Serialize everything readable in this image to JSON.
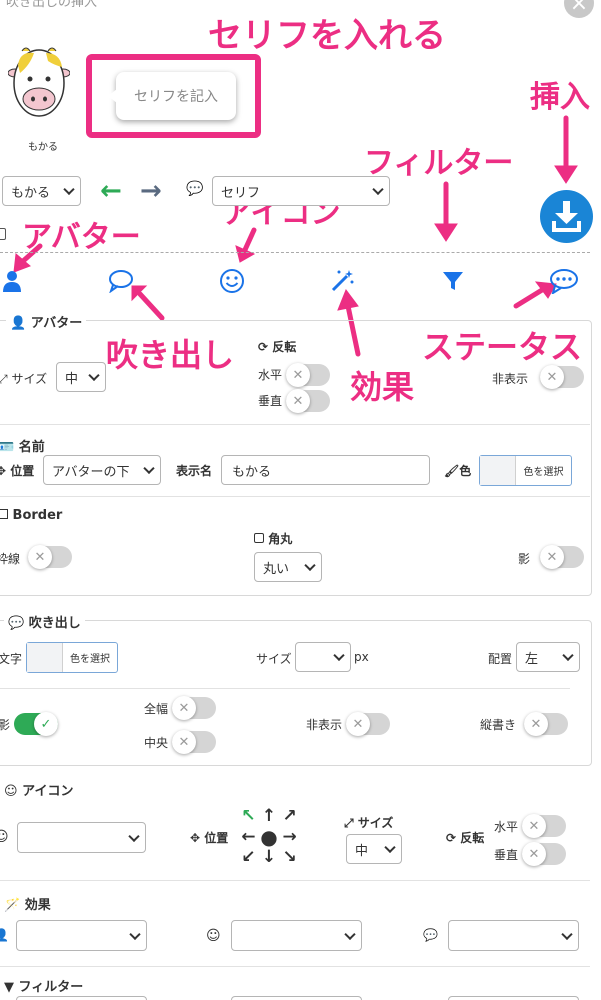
{
  "window": {
    "title": "吹き出しの挿入"
  },
  "annotations": {
    "serif_insert": "セリフを入れる",
    "insert": "挿入",
    "filter": "フィルター",
    "avatar": "アバター",
    "icon": "アイコン",
    "balloon": "吹き出し",
    "effect": "効果",
    "status": "ステータス"
  },
  "preview": {
    "speech_placeholder": "セリフを記入",
    "avatar_name": "もかる"
  },
  "toolbar": {
    "avatar_select": "もかる",
    "serif_select": "セリフ"
  },
  "avatar_section": {
    "title": "アバター",
    "size_label": "サイズ",
    "size_value": "中",
    "flip_label": "反転",
    "horizontal": "水平",
    "vertical": "垂直",
    "hide": "非表示"
  },
  "name_section": {
    "title": "名前",
    "position_label": "位置",
    "position_value": "アバターの下",
    "display_name_label": "表示名",
    "display_name_value": "もかる",
    "color_label": "色",
    "color_button": "色を選択"
  },
  "border_section": {
    "title": "Border",
    "frame": "枠線",
    "rounded_label": "角丸",
    "rounded_value": "丸い",
    "shadow": "影"
  },
  "balloon_section": {
    "title": "吹き出し",
    "text_label": "文字",
    "color_button": "色を選択",
    "size_label": "サイズ",
    "size_unit": "px",
    "align_label": "配置",
    "align_value": "左",
    "shadow": "影",
    "full_width": "全幅",
    "center": "中央",
    "hide": "非表示",
    "vertical_writing": "縦書き"
  },
  "icon_section": {
    "title": "アイコン",
    "position_label": "位置",
    "size_label": "サイズ",
    "size_value": "中",
    "flip_label": "反転",
    "horizontal": "水平",
    "vertical": "垂直"
  },
  "effect_section": {
    "title": "効果"
  },
  "filter_section": {
    "title": "フィルター"
  },
  "colors": {
    "accent_pink": "#ec2e83",
    "primary_blue": "#1a73e8",
    "insert_blue": "#1a85d6",
    "toggle_on": "#2eaa56"
  }
}
